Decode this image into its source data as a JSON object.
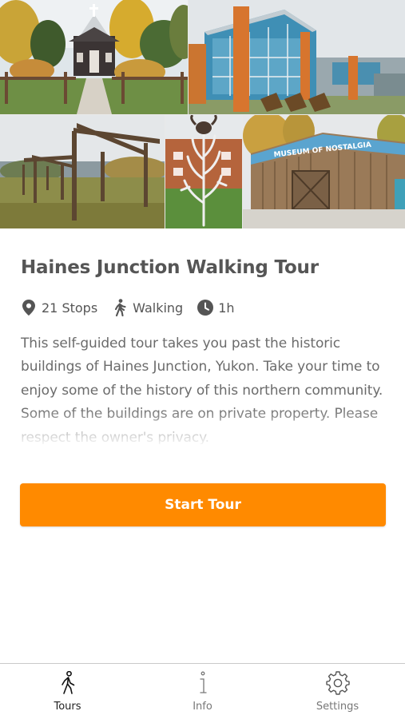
{
  "tour": {
    "title": "Haines Junction Walking Tour",
    "meta": [
      {
        "icon": "location-pin-icon",
        "label": "21 Stops"
      },
      {
        "icon": "walking-icon",
        "label": "Walking"
      },
      {
        "icon": "clock-icon",
        "label": "1h"
      }
    ],
    "description": "This self-guided tour takes you past the historic buildings of Haines Junction, Yukon. Take your time to enjoy some of the history of this northern community. Some of the buildings are on private property. Please respect the owner's privacy.",
    "start_button": "Start Tour"
  },
  "photos": {
    "museum_sign": "MUSEUM OF NOSTALGIA"
  },
  "tabs": [
    {
      "icon": "walking-icon",
      "label": "Tours",
      "active": true
    },
    {
      "icon": "info-icon",
      "label": "Info",
      "active": false
    },
    {
      "icon": "gear-icon",
      "label": "Settings",
      "active": false
    }
  ],
  "colors": {
    "accent": "#ff8a00",
    "text": "#555555",
    "muted": "#6b6b6b"
  }
}
